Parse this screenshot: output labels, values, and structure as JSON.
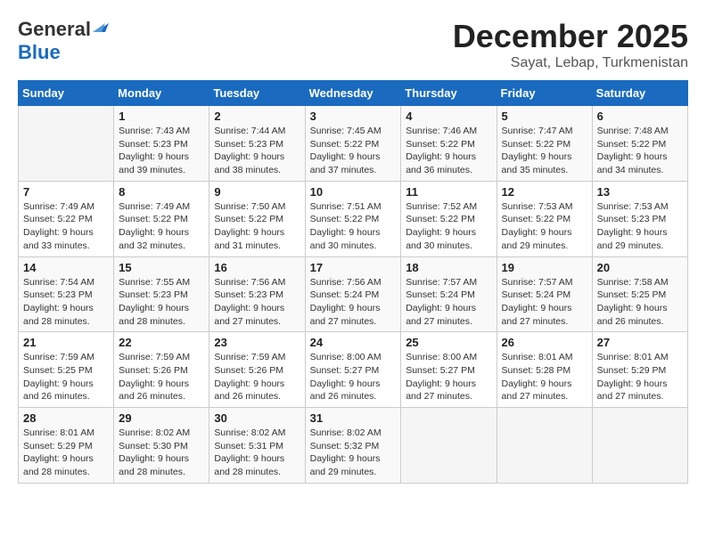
{
  "header": {
    "logo_general": "General",
    "logo_blue": "Blue",
    "month_year": "December 2025",
    "location": "Sayat, Lebap, Turkmenistan"
  },
  "weekdays": [
    "Sunday",
    "Monday",
    "Tuesday",
    "Wednesday",
    "Thursday",
    "Friday",
    "Saturday"
  ],
  "weeks": [
    [
      {
        "day": "",
        "text": ""
      },
      {
        "day": "1",
        "text": "Sunrise: 7:43 AM\nSunset: 5:23 PM\nDaylight: 9 hours\nand 39 minutes."
      },
      {
        "day": "2",
        "text": "Sunrise: 7:44 AM\nSunset: 5:23 PM\nDaylight: 9 hours\nand 38 minutes."
      },
      {
        "day": "3",
        "text": "Sunrise: 7:45 AM\nSunset: 5:22 PM\nDaylight: 9 hours\nand 37 minutes."
      },
      {
        "day": "4",
        "text": "Sunrise: 7:46 AM\nSunset: 5:22 PM\nDaylight: 9 hours\nand 36 minutes."
      },
      {
        "day": "5",
        "text": "Sunrise: 7:47 AM\nSunset: 5:22 PM\nDaylight: 9 hours\nand 35 minutes."
      },
      {
        "day": "6",
        "text": "Sunrise: 7:48 AM\nSunset: 5:22 PM\nDaylight: 9 hours\nand 34 minutes."
      }
    ],
    [
      {
        "day": "7",
        "text": "Sunrise: 7:49 AM\nSunset: 5:22 PM\nDaylight: 9 hours\nand 33 minutes."
      },
      {
        "day": "8",
        "text": "Sunrise: 7:49 AM\nSunset: 5:22 PM\nDaylight: 9 hours\nand 32 minutes."
      },
      {
        "day": "9",
        "text": "Sunrise: 7:50 AM\nSunset: 5:22 PM\nDaylight: 9 hours\nand 31 minutes."
      },
      {
        "day": "10",
        "text": "Sunrise: 7:51 AM\nSunset: 5:22 PM\nDaylight: 9 hours\nand 30 minutes."
      },
      {
        "day": "11",
        "text": "Sunrise: 7:52 AM\nSunset: 5:22 PM\nDaylight: 9 hours\nand 30 minutes."
      },
      {
        "day": "12",
        "text": "Sunrise: 7:53 AM\nSunset: 5:22 PM\nDaylight: 9 hours\nand 29 minutes."
      },
      {
        "day": "13",
        "text": "Sunrise: 7:53 AM\nSunset: 5:23 PM\nDaylight: 9 hours\nand 29 minutes."
      }
    ],
    [
      {
        "day": "14",
        "text": "Sunrise: 7:54 AM\nSunset: 5:23 PM\nDaylight: 9 hours\nand 28 minutes."
      },
      {
        "day": "15",
        "text": "Sunrise: 7:55 AM\nSunset: 5:23 PM\nDaylight: 9 hours\nand 28 minutes."
      },
      {
        "day": "16",
        "text": "Sunrise: 7:56 AM\nSunset: 5:23 PM\nDaylight: 9 hours\nand 27 minutes."
      },
      {
        "day": "17",
        "text": "Sunrise: 7:56 AM\nSunset: 5:24 PM\nDaylight: 9 hours\nand 27 minutes."
      },
      {
        "day": "18",
        "text": "Sunrise: 7:57 AM\nSunset: 5:24 PM\nDaylight: 9 hours\nand 27 minutes."
      },
      {
        "day": "19",
        "text": "Sunrise: 7:57 AM\nSunset: 5:24 PM\nDaylight: 9 hours\nand 27 minutes."
      },
      {
        "day": "20",
        "text": "Sunrise: 7:58 AM\nSunset: 5:25 PM\nDaylight: 9 hours\nand 26 minutes."
      }
    ],
    [
      {
        "day": "21",
        "text": "Sunrise: 7:59 AM\nSunset: 5:25 PM\nDaylight: 9 hours\nand 26 minutes."
      },
      {
        "day": "22",
        "text": "Sunrise: 7:59 AM\nSunset: 5:26 PM\nDaylight: 9 hours\nand 26 minutes."
      },
      {
        "day": "23",
        "text": "Sunrise: 7:59 AM\nSunset: 5:26 PM\nDaylight: 9 hours\nand 26 minutes."
      },
      {
        "day": "24",
        "text": "Sunrise: 8:00 AM\nSunset: 5:27 PM\nDaylight: 9 hours\nand 26 minutes."
      },
      {
        "day": "25",
        "text": "Sunrise: 8:00 AM\nSunset: 5:27 PM\nDaylight: 9 hours\nand 27 minutes."
      },
      {
        "day": "26",
        "text": "Sunrise: 8:01 AM\nSunset: 5:28 PM\nDaylight: 9 hours\nand 27 minutes."
      },
      {
        "day": "27",
        "text": "Sunrise: 8:01 AM\nSunset: 5:29 PM\nDaylight: 9 hours\nand 27 minutes."
      }
    ],
    [
      {
        "day": "28",
        "text": "Sunrise: 8:01 AM\nSunset: 5:29 PM\nDaylight: 9 hours\nand 28 minutes."
      },
      {
        "day": "29",
        "text": "Sunrise: 8:02 AM\nSunset: 5:30 PM\nDaylight: 9 hours\nand 28 minutes."
      },
      {
        "day": "30",
        "text": "Sunrise: 8:02 AM\nSunset: 5:31 PM\nDaylight: 9 hours\nand 28 minutes."
      },
      {
        "day": "31",
        "text": "Sunrise: 8:02 AM\nSunset: 5:32 PM\nDaylight: 9 hours\nand 29 minutes."
      },
      {
        "day": "",
        "text": ""
      },
      {
        "day": "",
        "text": ""
      },
      {
        "day": "",
        "text": ""
      }
    ]
  ]
}
